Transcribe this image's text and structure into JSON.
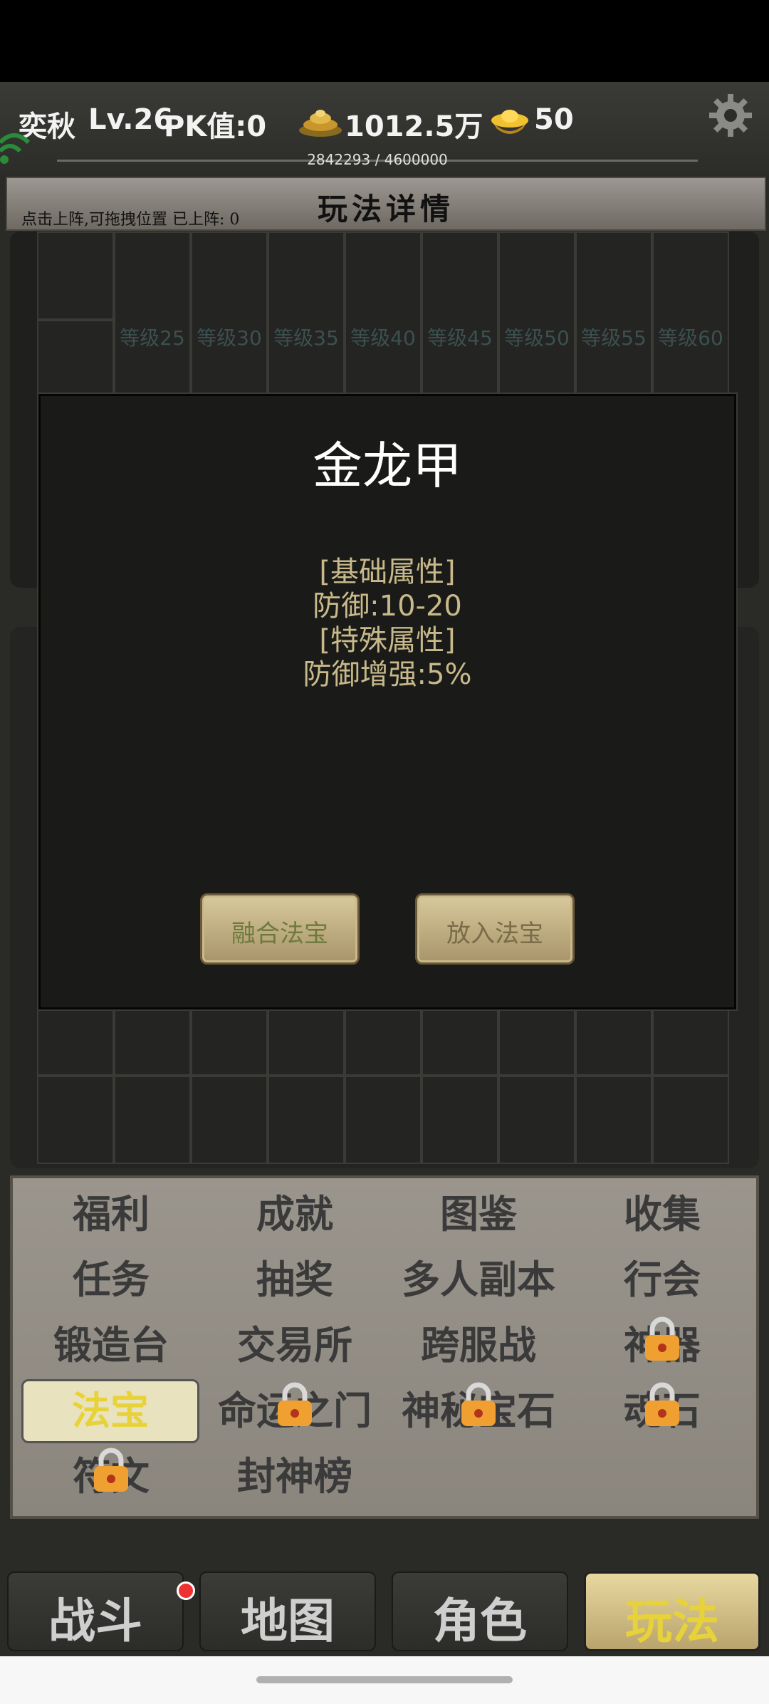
{
  "header": {
    "player_name": "奕秋",
    "level": "Lv.26",
    "pk": "PK值:0",
    "gold": "1012.5万",
    "ingots": "50",
    "exp": "2842293 / 4600000"
  },
  "title": {
    "text": "玩法详情",
    "hint": "点击上阵,可拖拽位置 已上阵: 0"
  },
  "grid": {
    "level_labels": [
      "等级25",
      "等级30",
      "等级35",
      "等级40",
      "等级45",
      "等级50",
      "等级55",
      "等级60"
    ]
  },
  "modal": {
    "title": "金龙甲",
    "base_header": "[基础属性]",
    "base_value": "防御:10-20",
    "special_header": "[特殊属性]",
    "special_value": "防御增强:5%",
    "fuse_button": "融合法宝",
    "equip_button": "放入法宝"
  },
  "menu": {
    "items": [
      {
        "label": "福利",
        "locked": false
      },
      {
        "label": "成就",
        "locked": false
      },
      {
        "label": "图鉴",
        "locked": false
      },
      {
        "label": "收集",
        "locked": false
      },
      {
        "label": "任务",
        "locked": false
      },
      {
        "label": "抽奖",
        "locked": false
      },
      {
        "label": "多人副本",
        "locked": false
      },
      {
        "label": "行会",
        "locked": false
      },
      {
        "label": "锻造台",
        "locked": false
      },
      {
        "label": "交易所",
        "locked": false
      },
      {
        "label": "跨服战",
        "locked": false
      },
      {
        "label": "神器",
        "locked": true
      },
      {
        "label": "法宝",
        "locked": false,
        "active": true
      },
      {
        "label": "命运之门",
        "locked": true
      },
      {
        "label": "神秘宝石",
        "locked": true
      },
      {
        "label": "魂石",
        "locked": true
      },
      {
        "label": "符文",
        "locked": true
      },
      {
        "label": "封神榜",
        "locked": false
      }
    ]
  },
  "nav": {
    "battle": "战斗",
    "map": "地图",
    "character": "角色",
    "gameplay": "玩法"
  },
  "colors": {
    "accent_gold": "#e8d23a",
    "attr_text": "#c8b98a",
    "button_text": "#6e7a3c"
  }
}
